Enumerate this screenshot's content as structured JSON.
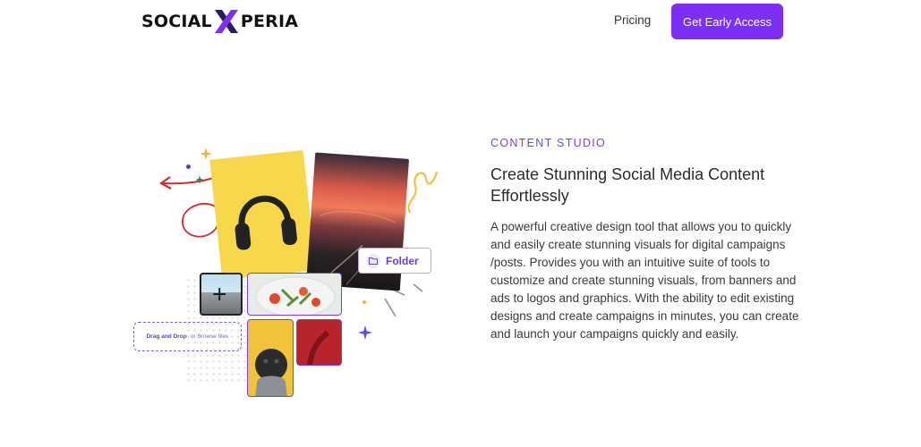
{
  "header": {
    "logo_left": "SOCIAL",
    "logo_right": "PERIA",
    "nav_pricing": "Pricing",
    "cta_label": "Get Early Access"
  },
  "feature": {
    "eyebrow": "CONTENT STUDIO",
    "headline": "Create Stunning Social Media Content Effortlessly",
    "body": "A powerful creative design tool that allows you to quickly and easily create stunning visuals for digital campaigns /posts. Provides you with an intuitive suite of tools to customize and create stunning visuals, from banners and ads to logos and graphics. With the ability to edit existing designs and create campaigns in minutes, you can create and launch your campaigns quickly and easily."
  },
  "illustration": {
    "folder_label": "Folder",
    "drag_drop_label": "Drag and Drop",
    "browse_label": "or Browse files",
    "add_symbol": "+"
  },
  "colors": {
    "brand_purple": "#7b2ff7",
    "eyebrow_purple": "#7b3fe4",
    "card_yellow": "#f7d84a",
    "arrow_red": "#d12b2b"
  },
  "icons": [
    "x-logo-icon",
    "folder-icon",
    "plus-icon",
    "sparkle-icon",
    "arrow-icon"
  ]
}
